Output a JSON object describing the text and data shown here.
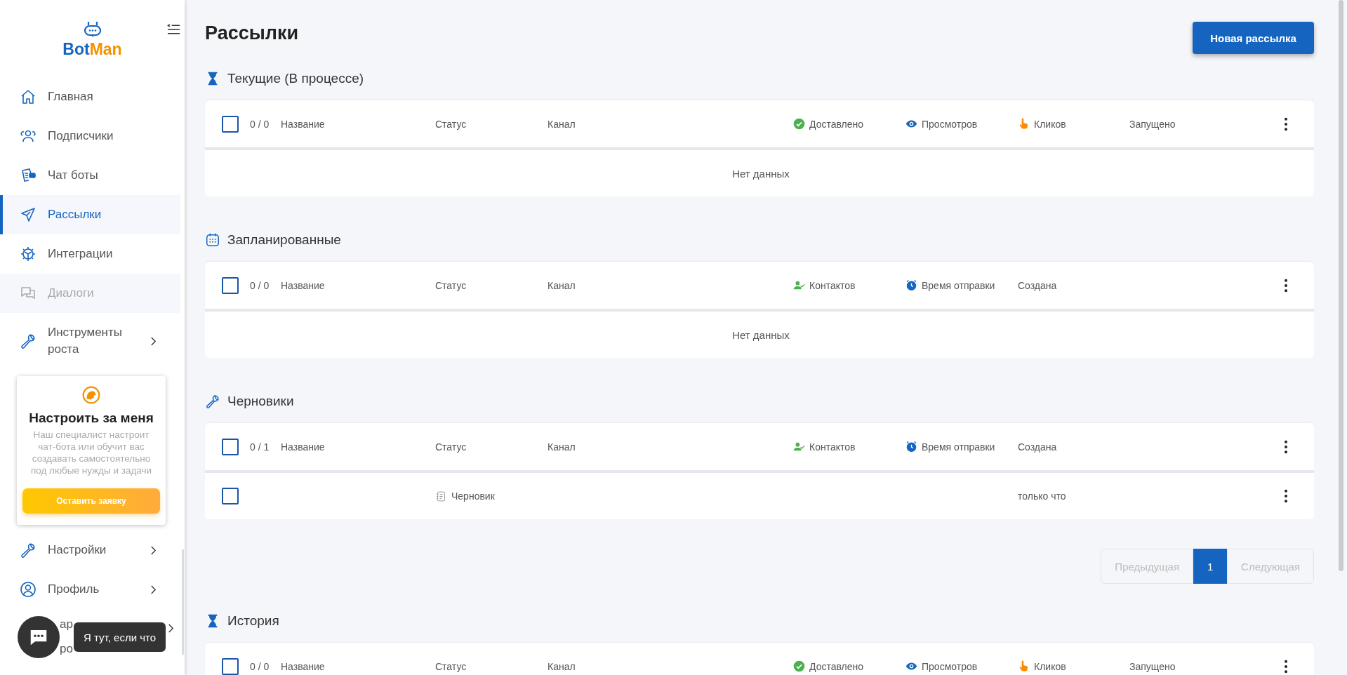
{
  "sidebar": {
    "logo": {
      "part_a": "Bot",
      "part_b": "Man"
    },
    "items_top": [
      {
        "kind": "home",
        "label": "Главная",
        "selected": false,
        "disabled": false,
        "expandable": false
      },
      {
        "kind": "subscribers",
        "label": "Подписчики",
        "selected": false,
        "disabled": false,
        "expandable": false
      },
      {
        "kind": "bots",
        "label": "Чат боты",
        "selected": false,
        "disabled": false,
        "expandable": false
      },
      {
        "kind": "mailings",
        "label": "Рассылки",
        "selected": true,
        "disabled": false,
        "expandable": false
      },
      {
        "kind": "integrations",
        "label": "Интеграции",
        "selected": false,
        "disabled": false,
        "expandable": false
      },
      {
        "kind": "dialogs",
        "label": "Диалоги",
        "selected": false,
        "disabled": true,
        "expandable": false
      },
      {
        "kind": "tools",
        "label": "Инструменты роста",
        "selected": false,
        "disabled": false,
        "expandable": true
      }
    ],
    "promo": {
      "title": "Настроить за меня",
      "text": "Наш специалист настроит чат-бота или обучит вас создавать самостоятельно под любые нужды и задачи",
      "button": "Оставить заявку"
    },
    "items_bottom": [
      {
        "kind": "settings",
        "label": "Настройки",
        "selected": false,
        "disabled": false,
        "expandable": true
      },
      {
        "kind": "profile",
        "label": "Профиль",
        "selected": false,
        "disabled": false,
        "expandable": true
      }
    ],
    "covered_item": {
      "line_1": "ар",
      "line_2": "ро",
      "expandable": true
    }
  },
  "chat_widget": {
    "tooltip": "Я тут, если что"
  },
  "page": {
    "title": "Рассылки",
    "new_button": "Новая рассылка"
  },
  "sections": [
    {
      "kind": "current",
      "title": "Текущие (В процессе)",
      "checked": false,
      "counter": "0 / 0",
      "columns": [
        {
          "kind": "plain",
          "label": "Название"
        },
        {
          "kind": "plain",
          "label": "Статус"
        },
        {
          "kind": "plain",
          "label": "Канал"
        },
        {
          "kind": "delivered",
          "label": "Доставлено"
        },
        {
          "kind": "views",
          "label": "Просмотров"
        },
        {
          "kind": "clicks",
          "label": "Кликов"
        },
        {
          "kind": "plain",
          "label": "Запущено"
        }
      ],
      "empty_text": "Нет данных"
    },
    {
      "kind": "scheduled",
      "title": "Запланированные",
      "checked": false,
      "counter": "0 / 0",
      "columns": [
        {
          "kind": "plain",
          "label": "Название"
        },
        {
          "kind": "plain",
          "label": "Статус"
        },
        {
          "kind": "plain",
          "label": "Канал"
        },
        {
          "kind": "contacts",
          "label": "Контактов"
        },
        {
          "kind": "send-time",
          "label": "Время отправки"
        },
        {
          "kind": "plain",
          "label": "Создана"
        }
      ],
      "empty_text": "Нет данных"
    },
    {
      "kind": "drafts",
      "title": "Черновики",
      "checked": false,
      "counter": "0 / 1",
      "columns": [
        {
          "kind": "plain",
          "label": "Название"
        },
        {
          "kind": "plain",
          "label": "Статус"
        },
        {
          "kind": "plain",
          "label": "Канал"
        },
        {
          "kind": "contacts",
          "label": "Контактов"
        },
        {
          "kind": "send-time",
          "label": "Время отправки"
        },
        {
          "kind": "plain",
          "label": "Создана"
        }
      ],
      "rows": [
        {
          "checked": false,
          "status": "Черновик",
          "created": "только что"
        }
      ],
      "pagination": {
        "prev": "Предыдущая",
        "pages": [
          {
            "label": "1",
            "selected": true
          }
        ],
        "next": "Следующая"
      }
    },
    {
      "kind": "history",
      "title": "История",
      "checked": false,
      "counter": "0 / 0",
      "columns": [
        {
          "kind": "plain",
          "label": "Название"
        },
        {
          "kind": "plain",
          "label": "Статус"
        },
        {
          "kind": "plain",
          "label": "Канал"
        },
        {
          "kind": "delivered",
          "label": "Доставлено"
        },
        {
          "kind": "views",
          "label": "Просмотров"
        },
        {
          "kind": "clicks",
          "label": "Кликов"
        },
        {
          "kind": "plain",
          "label": "Запущено"
        }
      ]
    }
  ]
}
